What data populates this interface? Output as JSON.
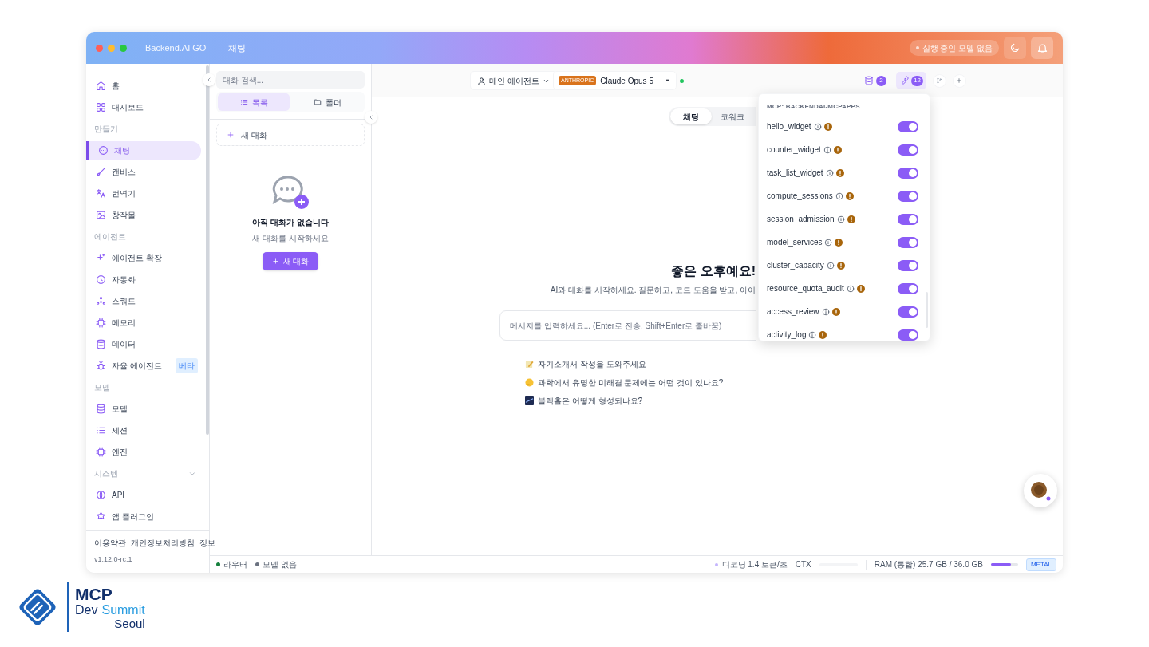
{
  "window": {
    "app_name": "Backend.AI GO",
    "title": "채팅",
    "model_status": "실행 중인 모델 없음"
  },
  "sidebar": {
    "sections": [
      {
        "items": [
          {
            "label": "홈",
            "selected": false
          },
          {
            "label": "대시보드",
            "selected": false
          }
        ]
      },
      {
        "heading": "만들기",
        "items": [
          {
            "label": "채팅",
            "selected": true
          },
          {
            "label": "캔버스",
            "selected": false
          },
          {
            "label": "번역기",
            "selected": false
          },
          {
            "label": "창작물",
            "selected": false
          }
        ]
      },
      {
        "heading": "에이전트",
        "items": [
          {
            "label": "에이전트 확장",
            "selected": false
          },
          {
            "label": "자동화",
            "selected": false
          },
          {
            "label": "스쿼드",
            "selected": false
          },
          {
            "label": "메모리",
            "selected": false
          },
          {
            "label": "데이터",
            "selected": false
          },
          {
            "label": "자율 에이전트",
            "selected": false,
            "badge": "베타"
          }
        ]
      },
      {
        "heading": "모델",
        "items": [
          {
            "label": "모델",
            "selected": false
          },
          {
            "label": "세션",
            "selected": false
          },
          {
            "label": "엔진",
            "selected": false
          }
        ]
      },
      {
        "heading": "시스템",
        "expanded": true,
        "items": [
          {
            "label": "API",
            "selected": false
          },
          {
            "label": "앱 플러그인",
            "selected": false
          }
        ]
      }
    ],
    "footer_links": [
      "이용약관",
      "개인정보처리방침",
      "정보"
    ],
    "version": "v1.12.0-rc.1"
  },
  "conversation_panel": {
    "search": {
      "placeholder": "대화 검색..."
    },
    "view_tabs": [
      {
        "label": "목록",
        "selected": true
      },
      {
        "label": "폴더",
        "selected": false
      }
    ],
    "new_chat": "새 대화",
    "empty_title": "아직 대화가 없습니다",
    "empty_subtitle": "새 대화를 시작하세요",
    "empty_button": "새 대화"
  },
  "top_bar": {
    "agent": "메인 에이전트",
    "model": {
      "provider": "ANTHROPIC",
      "name": "Claude Opus 5",
      "online": true
    },
    "tool_buttons": [
      {
        "count": "2",
        "selected": false
      },
      {
        "count": "12",
        "selected": true
      }
    ]
  },
  "main": {
    "mode_tabs": [
      {
        "label": "채팅",
        "selected": true
      },
      {
        "label": "코워크",
        "selected": false
      }
    ],
    "greeting": "좋은 오후예요!",
    "subtitle": "AI와 대화를 시작하세요. 질문하고, 코드 도움을 받고, 아이",
    "message_field": {
      "placeholder": "메시지를 입력하세요... (Enter로 전송, Shift+Enter로 줄바꿈)"
    },
    "suggestions": [
      "자기소개서 작성을 도와주세요",
      "과학에서 유명한 미해결 문제에는 어떤 것이 있나요?",
      "블랙홀은 어떻게 형성되나요?"
    ]
  },
  "tools_menu": {
    "heading": "MCP: BACKENDAI-MCPAPPS",
    "tools": [
      {
        "name": "hello_widget",
        "on": true
      },
      {
        "name": "counter_widget",
        "on": true
      },
      {
        "name": "task_list_widget",
        "on": true
      },
      {
        "name": "compute_sessions",
        "on": true
      },
      {
        "name": "session_admission",
        "on": true
      },
      {
        "name": "model_services",
        "on": true
      },
      {
        "name": "cluster_capacity",
        "on": true
      },
      {
        "name": "resource_quota_audit",
        "on": true
      },
      {
        "name": "access_review",
        "on": true
      },
      {
        "name": "activity_log",
        "on": true
      }
    ]
  },
  "status_bar": {
    "indicators": [
      {
        "label": "라우터",
        "color": "#15803d"
      },
      {
        "label": "모델 없음",
        "color": "#6b7280"
      }
    ],
    "decoding": "디코딩 1.4 토큰/초",
    "ctx_label": "CTX",
    "ram": {
      "label": "RAM (통합) 25.7 GB / 36.0 GB",
      "level": 0.75
    },
    "backend": "METAL"
  },
  "logo": {
    "title": "MCP",
    "word_1": "Dev",
    "word_2": "Summit",
    "city": "Seoul"
  }
}
